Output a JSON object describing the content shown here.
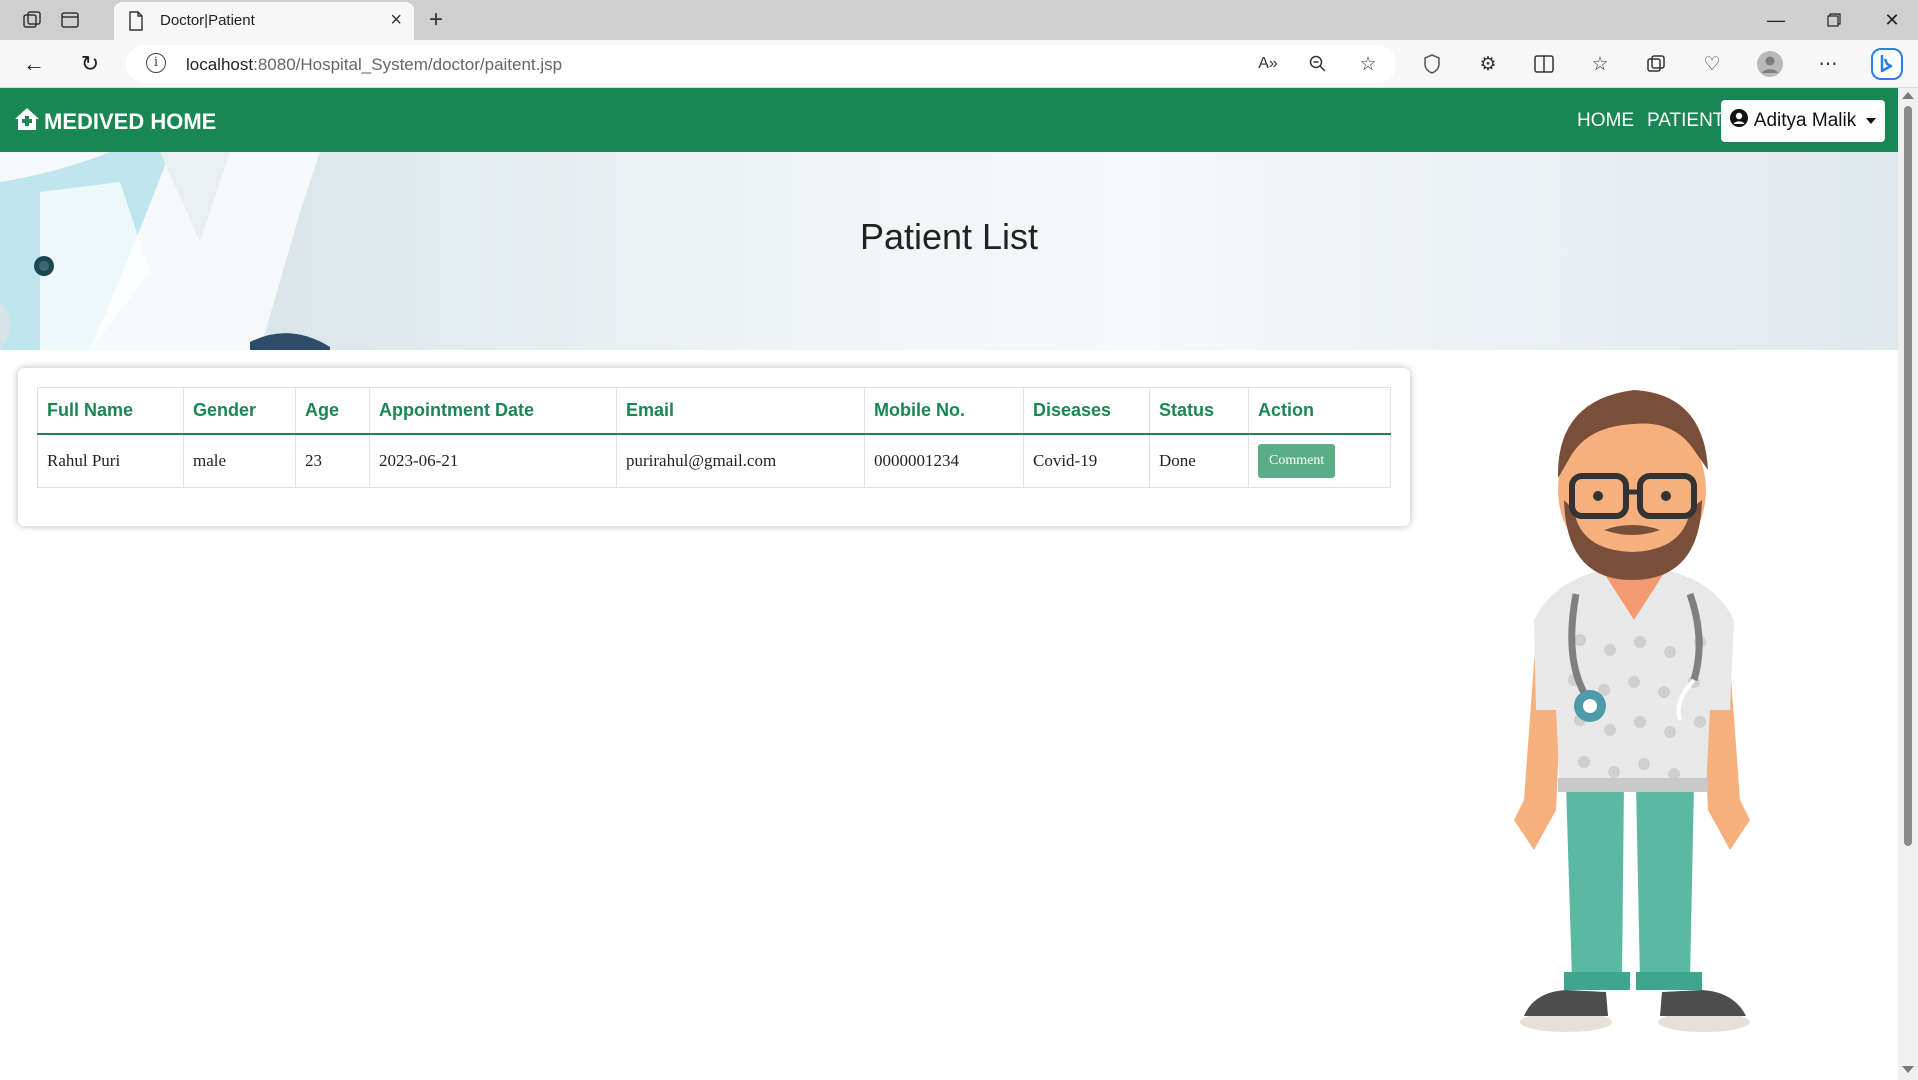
{
  "browser": {
    "tab_title": "Doctor|Patient",
    "url_host": "localhost",
    "url_rest": ":8080/Hospital_System/doctor/paitent.jsp"
  },
  "navbar": {
    "brand": "MEDIVED HOME",
    "links": [
      "HOME",
      "PATIENT"
    ],
    "user_name": "Aditya Malik",
    "color": "#198754"
  },
  "hero": {
    "title": "Patient List"
  },
  "table": {
    "headers": [
      "Full Name",
      "Gender",
      "Age",
      "Appointment Date",
      "Email",
      "Mobile No.",
      "Diseases",
      "Status",
      "Action"
    ],
    "rows": [
      {
        "full_name": "Rahul Puri",
        "gender": "male",
        "age": "23",
        "appointment_date": "2023-06-21",
        "email": "purirahul@gmail.com",
        "mobile": "0000001234",
        "diseases": "Covid-19",
        "status": "Done",
        "action_label": "Comment"
      }
    ]
  }
}
